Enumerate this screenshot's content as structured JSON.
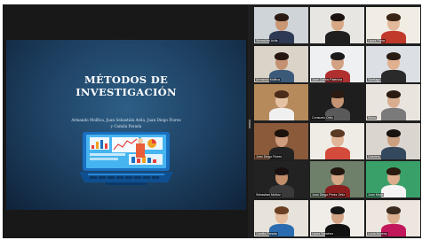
{
  "slide": {
    "title_line1": "MÉTODOS DE",
    "title_line2": "INVESTIGACIÓN",
    "authors_line1": "Armando Molfica, Juan Sebastián Avila, Juan Diego Flores",
    "authors_line2": "y Camila Parada"
  },
  "participants": [
    {
      "name": "Sebastián Avila"
    },
    {
      "name": ""
    },
    {
      "name": "Laura Parra"
    },
    {
      "name": "Armando Molfica"
    },
    {
      "name": "Juan Carlos Palencia"
    },
    {
      "name": "Santiago"
    },
    {
      "name": ""
    },
    {
      "name": "Consuelo Ortiz"
    },
    {
      "name": "Maria"
    },
    {
      "name": "Juan Diego Flores"
    },
    {
      "name": ""
    },
    {
      "name": "Gabriela"
    },
    {
      "name": "Sebastian Muñoz"
    },
    {
      "name": "Juan Diego Perez Ortiz"
    },
    {
      "name": "Juan Mejia"
    },
    {
      "name": "Camila Parada"
    },
    {
      "name": "Laura Sanchez"
    },
    {
      "name": "Lucia Moreno"
    }
  ]
}
